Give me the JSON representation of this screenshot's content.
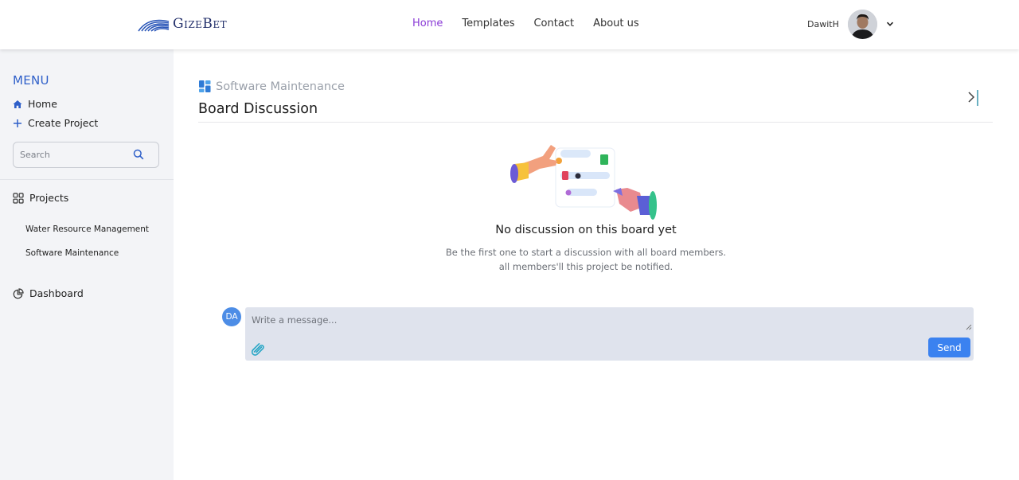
{
  "header": {
    "logo_text": "GizeBet",
    "nav": [
      {
        "label": "Home",
        "active": true
      },
      {
        "label": "Templates",
        "active": false
      },
      {
        "label": "Contact",
        "active": false
      },
      {
        "label": "About us",
        "active": false
      }
    ],
    "user": {
      "name": "DawitH",
      "avatar_icon": "user-photo",
      "menu_icon": "chevron-down-icon"
    }
  },
  "sidebar": {
    "menu_title": "MENU",
    "home_label": "Home",
    "create_label": "Create Project",
    "search_placeholder": "Search",
    "projects_label": "Projects",
    "projects": [
      "Water Resource Management",
      "Software Maintenance"
    ],
    "dashboard_label": "Dashboard"
  },
  "main": {
    "breadcrumb": "Software Maintenance",
    "title": "Board Discussion",
    "empty_state": {
      "title": "No discussion on this board yet",
      "description": "Be the first one to start a discussion with all board members. all members'll this project be notified."
    },
    "composer": {
      "avatar_initials": "DA",
      "placeholder": "Write a message...",
      "send_label": "Send"
    }
  },
  "colors": {
    "accent_active_nav": "#8a3bd6",
    "menu_title": "#2e5fc9",
    "send_button": "#3b82f0",
    "composer_bg": "#dfe3ed",
    "sidebar_bg": "#f3f4f7"
  }
}
